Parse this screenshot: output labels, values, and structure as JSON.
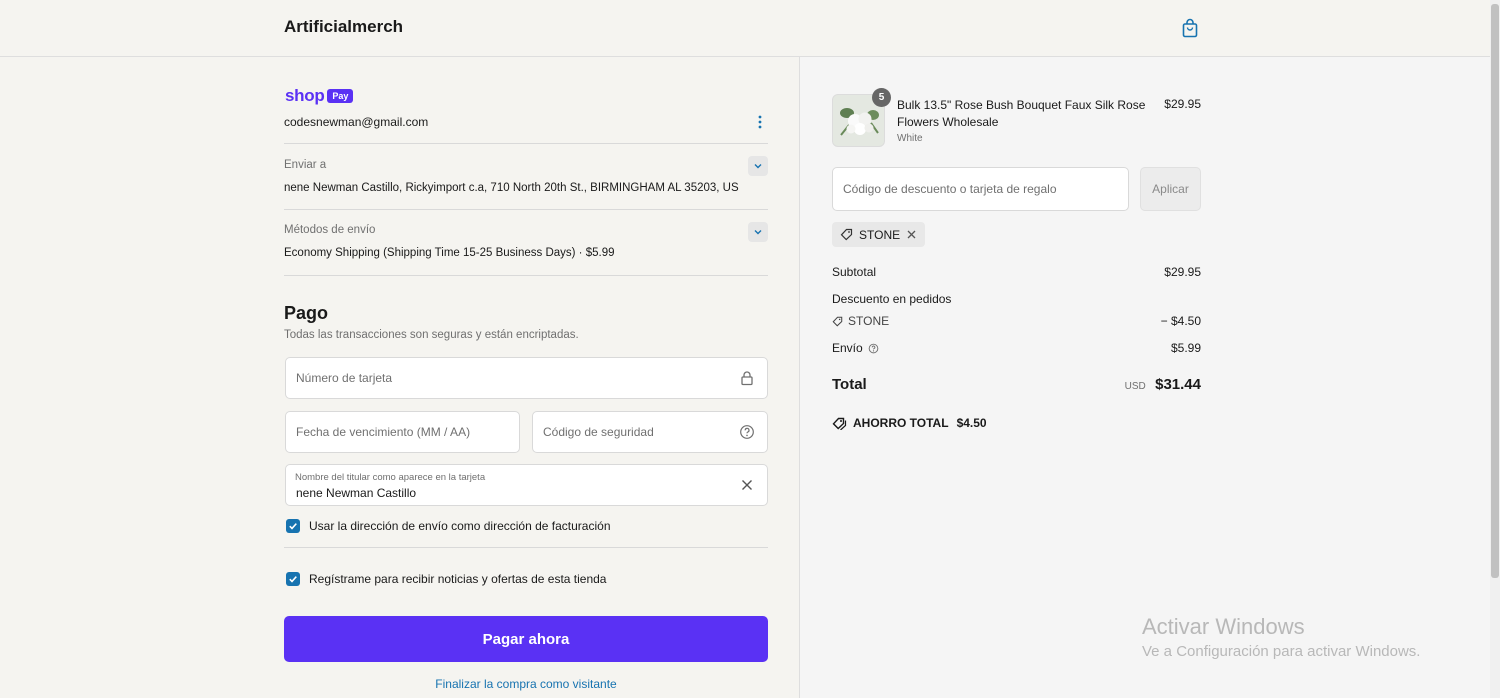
{
  "header": {
    "brand": "Artificialmerch",
    "cart_icon": "shopping-bag-icon"
  },
  "shop_pay": {
    "logo_word": "shop",
    "logo_pill": "Pay",
    "email": "codesnewman@gmail.com"
  },
  "shipping_address": {
    "label": "Enviar a",
    "value": "nene Newman Castillo, Rickyimport c.a, 710 North 20th St., BIRMINGHAM AL 35203, US"
  },
  "shipping_method": {
    "label": "Métodos de envío",
    "value": "Economy Shipping (Shipping Time 15-25 Business Days) · $5.99"
  },
  "payment": {
    "title": "Pago",
    "subtitle": "Todas las transacciones son seguras y están encriptadas.",
    "card_number_placeholder": "Número de tarjeta",
    "expiry_placeholder": "Fecha de vencimiento (MM / AA)",
    "security_placeholder": "Código de seguridad",
    "name_label": "Nombre del titular como aparece en la tarjeta",
    "name_value": "nene Newman Castillo",
    "billing_checkbox": "Usar la dirección de envío como dirección de facturación",
    "newsletter_checkbox": "Regístrame para recibir noticias y ofertas de esta tienda",
    "pay_button": "Pagar ahora",
    "guest_link": "Finalizar la compra como visitante"
  },
  "order": {
    "item": {
      "quantity": "5",
      "name": "Bulk 13.5\" Rose Bush Bouquet Faux Silk Rose Flowers Wholesale",
      "variant": "White",
      "price": "$29.95"
    },
    "discount_placeholder": "Código de descuento o tarjeta de regalo",
    "apply_button": "Aplicar",
    "applied_code": "STONE",
    "subtotal_label": "Subtotal",
    "subtotal_value": "$29.95",
    "order_discount_label": "Descuento en pedidos",
    "discount_code": "STONE",
    "discount_value": "− $4.50",
    "shipping_label": "Envío",
    "shipping_value": "$5.99",
    "total_label": "Total",
    "total_currency": "USD",
    "total_value": "$31.44",
    "savings_label": "AHORRO TOTAL",
    "savings_value": "$4.50"
  },
  "watermark": {
    "title": "Activar Windows",
    "subtitle": "Ve a Configuración para activar Windows."
  },
  "colors": {
    "shop_purple": "#5a31f4",
    "link_blue": "#1773b0"
  }
}
